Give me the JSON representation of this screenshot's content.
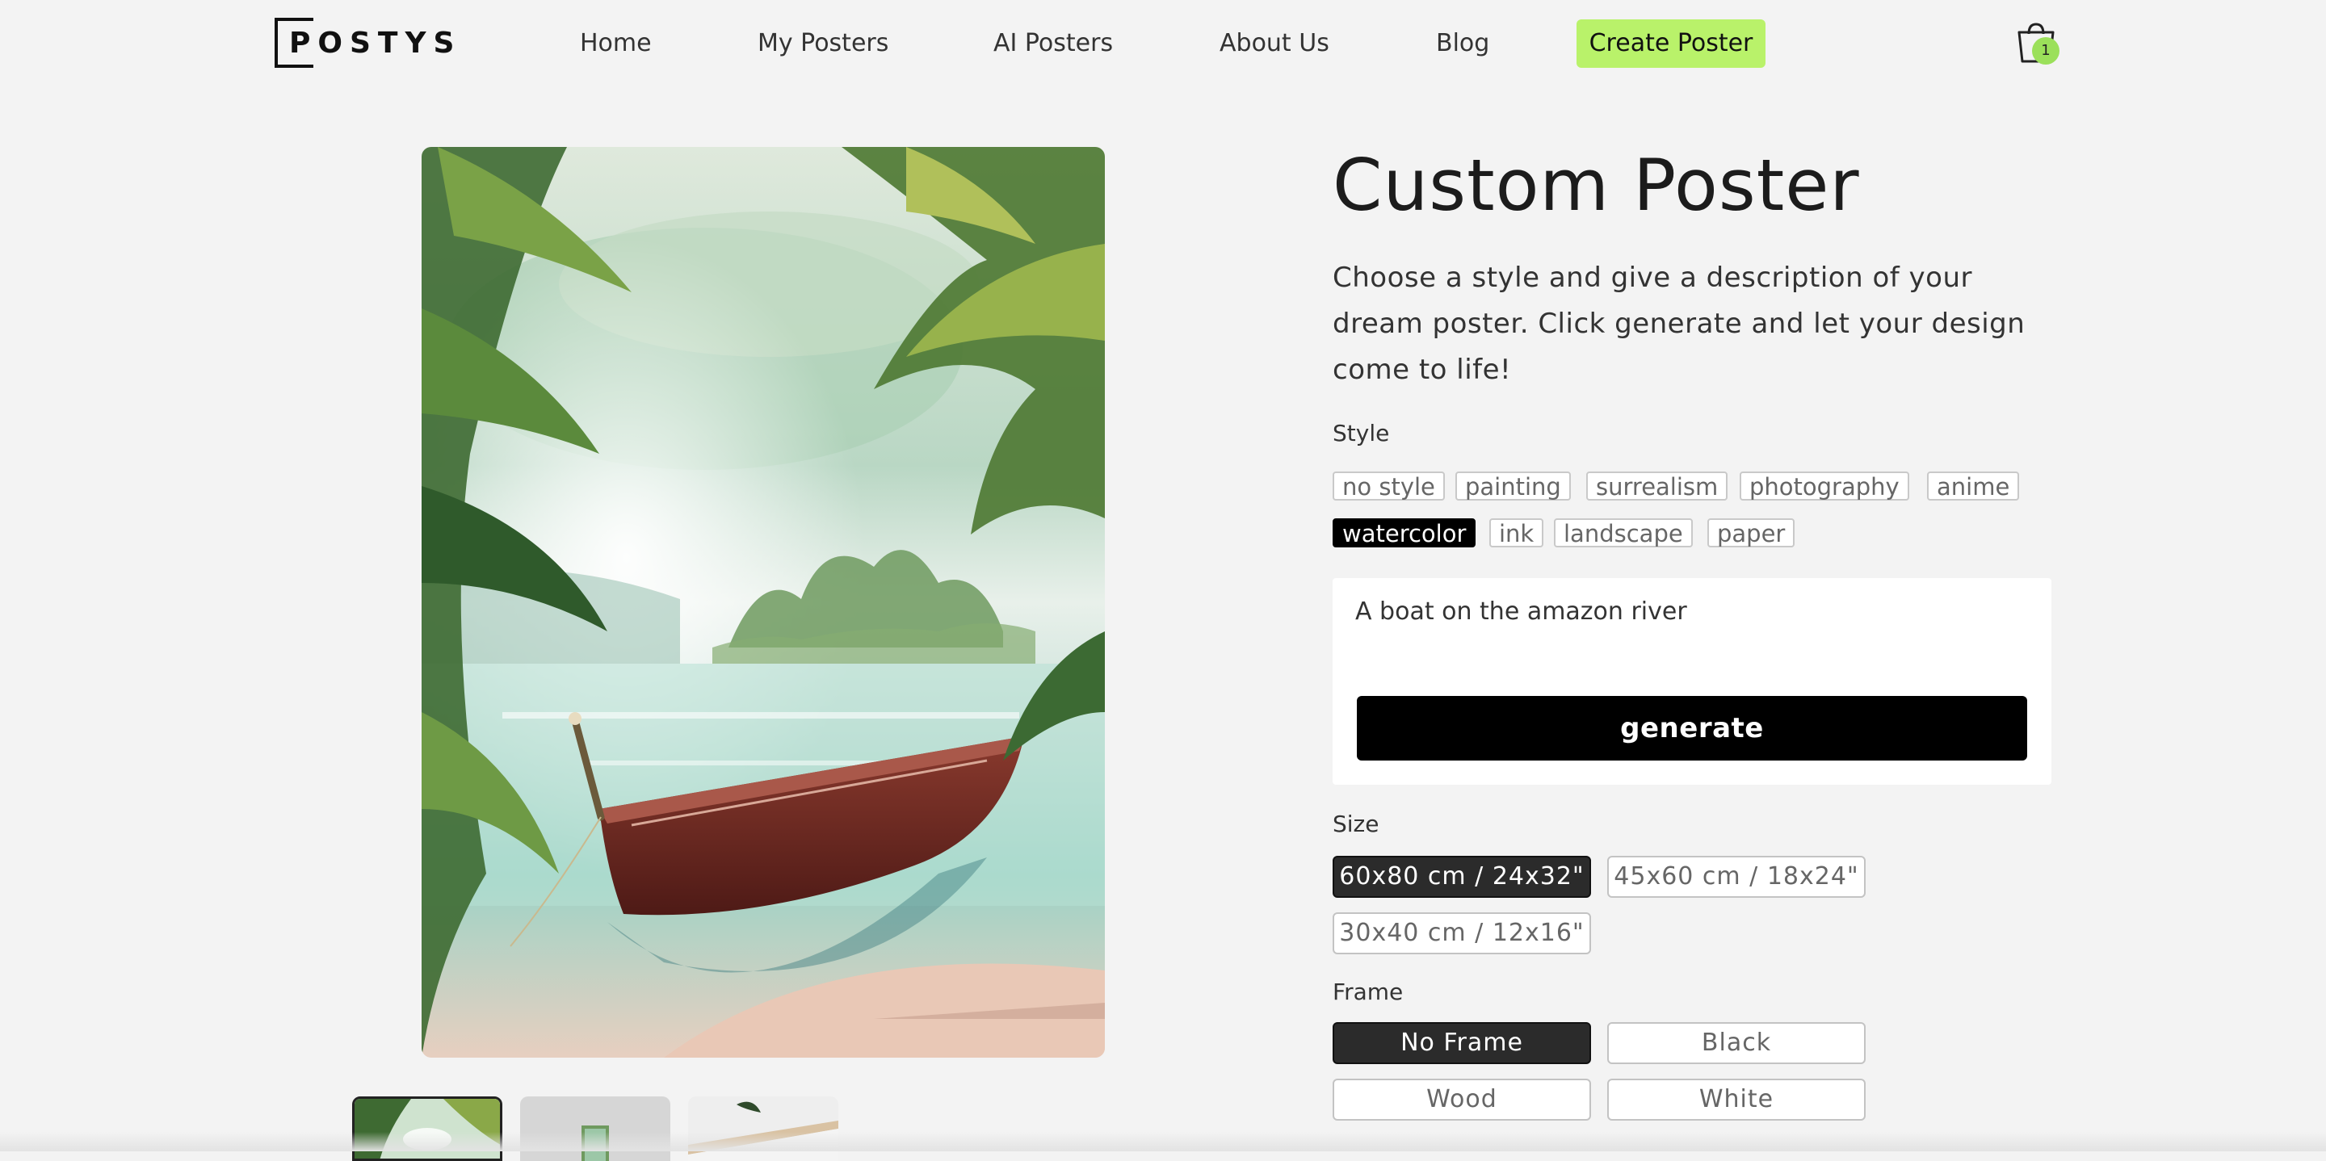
{
  "header": {
    "logo": "POSTYS",
    "nav": [
      {
        "label": "Home"
      },
      {
        "label": "My Posters"
      },
      {
        "label": "AI Posters"
      },
      {
        "label": "About Us"
      },
      {
        "label": "Blog"
      }
    ],
    "cta_label": "Create Poster",
    "cart_count": "1",
    "accent_color": "#b9f26a"
  },
  "product": {
    "title": "Custom Poster",
    "description": "Choose a style and give a description of your dream poster. Click generate and let your design come to life!",
    "style_label": "Style",
    "styles": [
      "no style",
      "painting",
      "surrealism",
      "photography",
      "anime",
      "watercolor",
      "ink",
      "landscape",
      "paper"
    ],
    "selected_style": "watercolor",
    "prompt": "A boat on the amazon river",
    "generate_label": "generate",
    "size_label": "Size",
    "sizes": [
      "60x80 cm / 24x32\"",
      "45x60 cm / 18x24\"",
      "30x40 cm / 12x16\""
    ],
    "selected_size": "60x80 cm / 24x32\"",
    "frame_label": "Frame",
    "frames": [
      "No Frame",
      "Black",
      "Wood",
      "White"
    ],
    "selected_frame": "No Frame"
  },
  "gallery": {
    "thumbnail_count": 3
  }
}
